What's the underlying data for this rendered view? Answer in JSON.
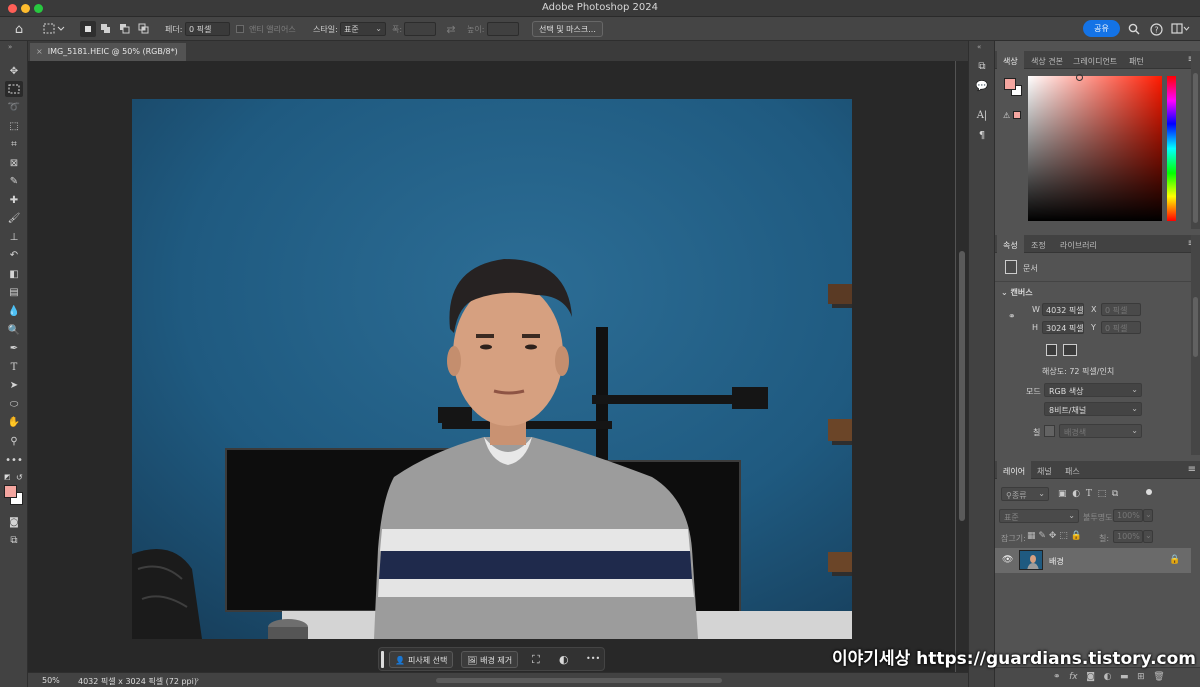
{
  "window": {
    "title": "Adobe Photoshop 2024"
  },
  "options_bar": {
    "feather_label": "페더:",
    "feather_value": "0 픽셀",
    "antialias_label": "앤티 앨리어스",
    "style_label": "스타일:",
    "style_value": "표준",
    "width_label": "폭:",
    "height_label": "높이:",
    "select_mask_button": "선택 및 마스크...",
    "share_button": "공유"
  },
  "document": {
    "tab_title": "IMG_5181.HEIC @ 50% (RGB/8*)"
  },
  "status_bar": {
    "zoom": "50%",
    "doc_info": "4032 픽셀 x 3024 픽셀 (72 ppi)"
  },
  "task_bar": {
    "select_subject": "피사체 선택",
    "remove_background": "배경 제거",
    "more": "•••"
  },
  "color_panel": {
    "tabs": [
      "색상",
      "색상 견본",
      "그레이디언트",
      "패턴"
    ],
    "foreground_color": "#f4a6a0",
    "background_color": "#ffffff"
  },
  "properties_panel": {
    "tabs": [
      "속성",
      "조정",
      "라이브러리"
    ],
    "doc_label": "문서",
    "canvas_header": "캔버스",
    "w_label": "W",
    "w_value": "4032 픽셀",
    "x_label": "X",
    "x_placeholder": "0 픽셀",
    "h_label": "H",
    "h_value": "3024 픽셀",
    "y_label": "Y",
    "y_placeholder": "0 픽셀",
    "resolution": "해상도: 72 픽셀/인치",
    "mode_label": "모드",
    "mode_value": "RGB 색상",
    "depth_value": "8비트/채널",
    "fill_label": "칠",
    "fill_value": "배경색"
  },
  "layers_panel": {
    "tabs": [
      "레이어",
      "채널",
      "패스"
    ],
    "filter_placeholder": "종류",
    "blend_mode": "표준",
    "opacity_label": "불투명도:",
    "opacity_value": "100%",
    "lock_label": "잠그기:",
    "fill_label": "칠:",
    "fill_value": "100%",
    "layers": [
      {
        "name": "배경",
        "visible": true,
        "locked": true
      }
    ]
  },
  "watermark": "이야기세상 https://guardians.tistory.com"
}
